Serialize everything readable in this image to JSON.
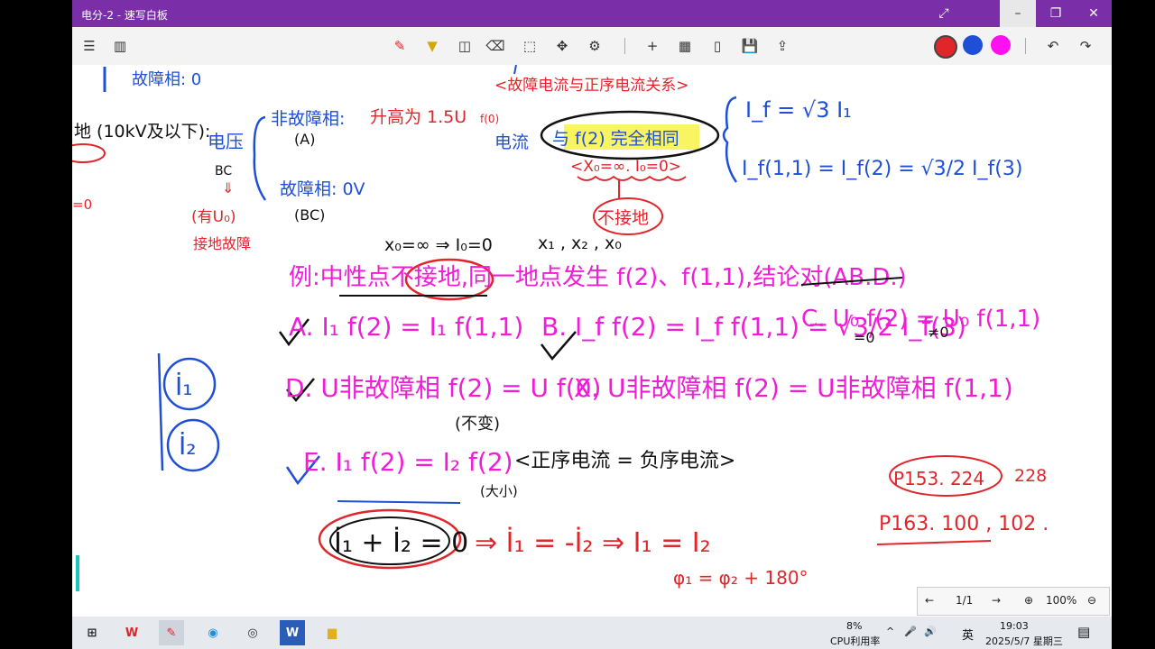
{
  "window": {
    "title": "电分-2 - 速写白板"
  },
  "colors": {
    "titlebar": "#7a2fa8",
    "ink_blue": "#1f4fd6",
    "ink_red": "#e0262b",
    "ink_magenta": "#f01cd6",
    "ink_black": "#111111"
  },
  "toolbar": {
    "left_icons": [
      "menu-icon",
      "book-icon"
    ],
    "tools": [
      "pen-icon",
      "highlighter-icon",
      "shape-icon",
      "eraser-icon",
      "lasso-icon",
      "move-icon",
      "settings-icon",
      "add-icon",
      "grid-icon",
      "page-icon",
      "save-icon",
      "export-icon"
    ],
    "palette": [
      "#e0262b",
      "#1f4fd6",
      "#ff10f0"
    ],
    "undo_icon": "undo-icon",
    "redo_icon": "redo-icon"
  },
  "notes": {
    "blue_top": "故障相: 0",
    "left_fragment": "地 (10kV及以下):",
    "voltage_label": "电压",
    "phase_bc": "BC",
    "nonfault_phase": "非故障相:",
    "nonfault_a": "(A)",
    "rise_to": "升高为 1.5U",
    "rise_sub": "f(0)",
    "fault_phase": "故障相: 0V",
    "fault_bc": "(BC)",
    "red_left1": "(有U₀)",
    "red_left2": "接地故障",
    "red_heading": "<故障电流与正序电流关系>",
    "current_label": "电流",
    "same_as": "与 f(2) 完全相同",
    "condition": "<X₀=∞. I₀=0>",
    "not_grounded": "不接地",
    "eq1": "I_f = √3 I₁",
    "eq2": "I_f(1,1) = I_f(2) = √3/2 I_f(3)",
    "x0_line": "x₀=∞ ⇒ I₀=0",
    "x_list": "x₁ , x₂ , x₀",
    "example": "例:中性点不接地,同一地点发生 f(2)、f(1,1),结论对(AB.D.)",
    "option_a": "A. I₁ f(2) = I₁ f(1,1)",
    "option_b": "B. I_f f(2) = I_f f(1,1) = √3/2 I_f(3)",
    "option_c": "C. U₀ f(2) = U₀ f(1,1)",
    "c_eq0": "=0",
    "c_ne0": "≠0",
    "option_d": "D. U非故障相 f(2) = U f(0)",
    "d_note": "(不变)",
    "option_x": "X. U非故障相 f(2) = U非故障相 f(1,1)",
    "option_e": "E. I₁ f(2) = I₂ f(2)",
    "e_note": "<正序电流 = 负序电流>",
    "e_paren": "(大小)",
    "bottom_box": "İ₁ + İ₂ = 0",
    "bottom_eq": "⇒ İ₁ = -İ₂ ⇒ I₁ = I₂",
    "phase_eq": "φ₁ = φ₂ + 180°",
    "blue_i1": "İ₁",
    "blue_i2": "İ₂",
    "ref1": "P153. 224",
    "ref1b": "228",
    "ref2": "P163. 100 , 102 ."
  },
  "pager": {
    "page": "1/1",
    "zoom": "100%"
  },
  "taskbar": {
    "apps": [
      "windows-icon",
      "wps-icon",
      "whiteboard-icon",
      "edge-icon",
      "obs-icon",
      "word-icon",
      "explorer-icon"
    ],
    "cpu_pct": "8%",
    "cpu_label": "CPU利用率",
    "ime": "英",
    "time": "19:03",
    "date": "2025/5/7 星期三"
  }
}
